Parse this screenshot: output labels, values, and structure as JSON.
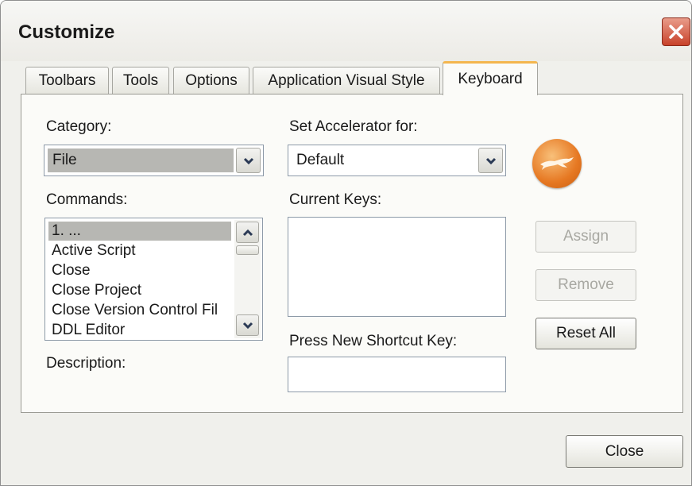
{
  "window": {
    "title": "Customize"
  },
  "tabs": [
    {
      "label": "Toolbars",
      "active": false
    },
    {
      "label": "Tools",
      "active": false
    },
    {
      "label": "Options",
      "active": false
    },
    {
      "label": "Application Visual Style",
      "active": false
    },
    {
      "label": "Keyboard",
      "active": true
    }
  ],
  "keyboard": {
    "category_label": "Category:",
    "category_value": "File",
    "accelerator_label": "Set Accelerator for:",
    "accelerator_value": "Default",
    "commands_label": "Commands:",
    "commands": [
      "1. ...",
      "Active Script",
      "Close",
      "Close Project",
      "Close Version Control Fil",
      "DDL Editor"
    ],
    "selected_command_index": 0,
    "current_keys_label": "Current Keys:",
    "description_label": "Description:",
    "press_shortcut_label": "Press New Shortcut Key:",
    "assign_label": "Assign",
    "remove_label": "Remove",
    "reset_all_label": "Reset All"
  },
  "footer": {
    "close_label": "Close"
  },
  "colors": {
    "active_tab_accent": "#f4b64e",
    "close_button": "#c8422a",
    "logo": "#e67822",
    "selection": "#b7b7b3"
  },
  "icons": {
    "window_close": "close-icon",
    "dropdown": "chevron-down-icon",
    "scroll_up": "chevron-up-icon",
    "scroll_down": "chevron-down-icon",
    "app_logo": "greyhound-logo-icon"
  }
}
